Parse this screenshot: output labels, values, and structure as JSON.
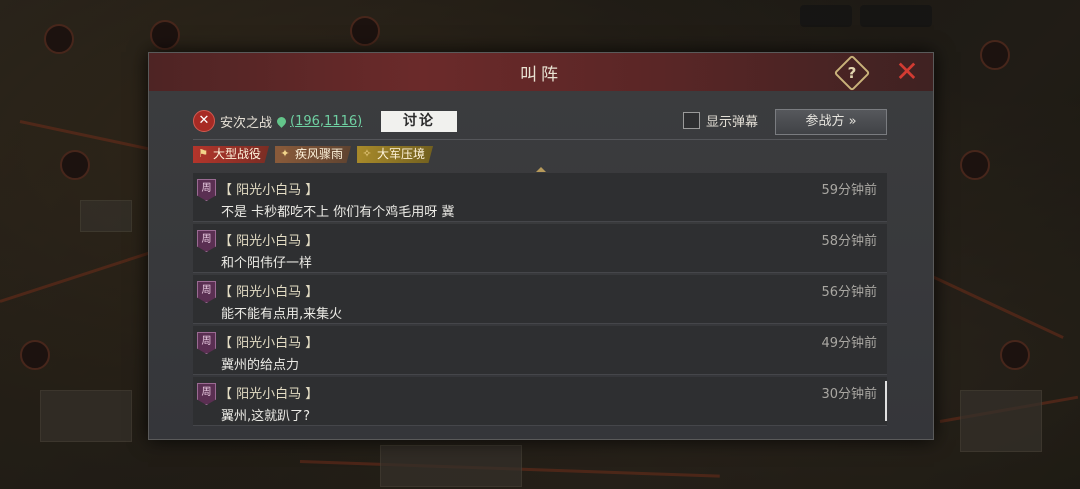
{
  "dialog": {
    "title": "叫阵",
    "help_label": "?",
    "close_label": "✕"
  },
  "battle": {
    "name": "安次之战",
    "coords": "(196,1116)",
    "discuss_label": "讨论",
    "danmaku_label": "显示弹幕",
    "danmaku_checked": false,
    "join_label": "参战方 »"
  },
  "tags": [
    {
      "label": "大型战役",
      "icon": "flag-icon"
    },
    {
      "label": "疾风骤雨",
      "icon": "wind-icon"
    },
    {
      "label": "大军压境",
      "icon": "army-icon"
    }
  ],
  "messages": [
    {
      "avatar": "周",
      "user": "【 阳光小白马 】",
      "time": "59分钟前",
      "text": "不是 卡秒都吃不上 你们有个鸡毛用呀 冀"
    },
    {
      "avatar": "周",
      "user": "【 阳光小白马 】",
      "time": "58分钟前",
      "text": "和个阳伟仔一样"
    },
    {
      "avatar": "周",
      "user": "【 阳光小白马 】",
      "time": "56分钟前",
      "text": "能不能有点用,来集火"
    },
    {
      "avatar": "周",
      "user": "【 阳光小白马 】",
      "time": "49分钟前",
      "text": "冀州的给点力"
    },
    {
      "avatar": "周",
      "user": "【 阳光小白马 】",
      "time": "30分钟前",
      "text": "翼州,这就趴了?"
    }
  ],
  "topbar": {
    "chip1": "",
    "chip2": ""
  },
  "colors": {
    "accent_red": "#d23b32",
    "coords_green": "#6fd0a2",
    "header_red": "#6b2a2a"
  }
}
